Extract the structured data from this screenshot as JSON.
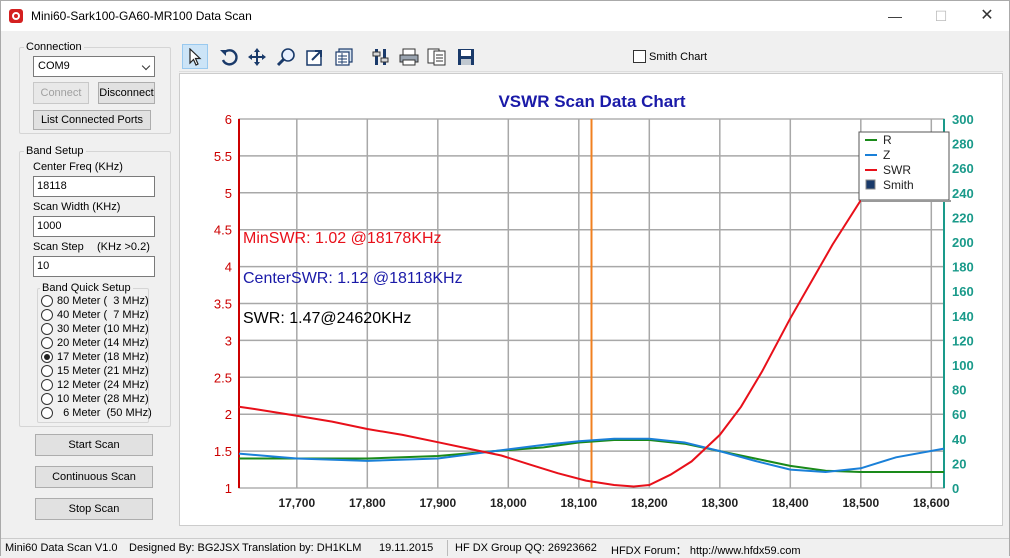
{
  "window": {
    "title": "Mini60-Sark100-GA60-MR100 Data Scan",
    "minimize": "—",
    "maximize": "☐",
    "close": "✕"
  },
  "connection": {
    "group_title": "Connection",
    "port_value": "COM9",
    "connect_label": "Connect",
    "disconnect_label": "Disconnect",
    "list_ports_label": "List Connected Ports"
  },
  "band_setup": {
    "group_title": "Band Setup",
    "center_freq_label": "Center Freq  (KHz)",
    "center_freq_value": "18118",
    "scan_width_label": "Scan Width   (KHz)",
    "scan_width_value": "1000",
    "scan_step_label": "Scan Step",
    "scan_step_hint": "(KHz >0.2)",
    "scan_step_value": "10",
    "quick_setup_title": "Band Quick Setup",
    "bands": [
      {
        "label": "80 Meter (  3 MHz)",
        "checked": false
      },
      {
        "label": "40 Meter (  7 MHz)",
        "checked": false
      },
      {
        "label": "30 Meter (10 MHz)",
        "checked": false
      },
      {
        "label": "20 Meter (14 MHz)",
        "checked": false
      },
      {
        "label": "17 Meter (18 MHz)",
        "checked": true
      },
      {
        "label": "15 Meter (21 MHz)",
        "checked": false
      },
      {
        "label": "12 Meter (24 MHz)",
        "checked": false
      },
      {
        "label": "10 Meter (28 MHz)",
        "checked": false
      },
      {
        "label": "  6 Meter  (50 MHz)",
        "checked": false
      }
    ]
  },
  "actions": {
    "start_scan": "Start Scan",
    "continuous_scan": "Continuous Scan",
    "stop_scan": "Stop Scan"
  },
  "toolbar": {
    "tools": [
      "pointer-icon",
      "rotate-icon",
      "pan-icon",
      "zoom-icon",
      "export-icon",
      "data-icon",
      "settings-icon",
      "print-icon",
      "copy-icon",
      "save-icon"
    ],
    "smith_chart_label": "Smith Chart",
    "smith_chart_checked": false
  },
  "status": {
    "version": "Mini60 Data Scan V1.0",
    "designed_by": "Designed By: BG2JSX",
    "translation": "Translation by: DH1KLM",
    "date": "19.11.2015",
    "group": "HF DX Group QQ: 26923662",
    "forum": "HFDX Forum：  http://www.hfdx59.com"
  },
  "colors": {
    "swr": "#e8101a",
    "r": "#1a8a1a",
    "z": "#1a80d8",
    "marker": "#f08020",
    "title": "#1a1aa8",
    "axis_left": "#cc0000",
    "axis_right": "#1a9a8a"
  },
  "chart_data": {
    "type": "line",
    "title": "VSWR Scan Data Chart",
    "xlim": [
      17618,
      18618
    ],
    "x_ticks": [
      "17,700",
      "17,800",
      "17,900",
      "18,000",
      "18,100",
      "18,200",
      "18,300",
      "18,400",
      "18,500",
      "18,600"
    ],
    "ylim_left": [
      1,
      6
    ],
    "y_ticks_left": [
      "1",
      "1.5",
      "2",
      "2.5",
      "3",
      "3.5",
      "4",
      "4.5",
      "5",
      "5.5",
      "6"
    ],
    "ylim_right": [
      0,
      300
    ],
    "y_ticks_right": [
      "0",
      "20",
      "40",
      "60",
      "80",
      "100",
      "120",
      "140",
      "160",
      "180",
      "200",
      "220",
      "240",
      "260",
      "280",
      "300"
    ],
    "grid": true,
    "legend_position": "top-right",
    "legend": [
      "R",
      "Z",
      "SWR",
      "Smith"
    ],
    "marker_x": 18118,
    "annotations": [
      {
        "text": "MinSWR: 1.02 @18178KHz",
        "color": "#e8101a"
      },
      {
        "text": "CenterSWR: 1.12 @18118KHz",
        "color": "#1a1aa8"
      },
      {
        "text": "SWR: 1.47@24620KHz",
        "color": "#000000"
      }
    ],
    "series": [
      {
        "name": "SWR",
        "axis": "left",
        "x": [
          17618,
          17640,
          17700,
          17750,
          17800,
          17850,
          17900,
          17950,
          17990,
          18030,
          18070,
          18110,
          18150,
          18178,
          18200,
          18230,
          18260,
          18300,
          18330,
          18360,
          18400,
          18430,
          18460,
          18500,
          18530,
          18560,
          18590,
          18618
        ],
        "values": [
          2.1,
          2.07,
          1.98,
          1.9,
          1.8,
          1.72,
          1.62,
          1.52,
          1.44,
          1.32,
          1.2,
          1.1,
          1.04,
          1.02,
          1.04,
          1.18,
          1.36,
          1.72,
          2.1,
          2.58,
          3.3,
          3.8,
          4.3,
          4.9,
          5.2,
          5.5,
          5.72,
          5.82
        ]
      },
      {
        "name": "R",
        "axis": "right",
        "x": [
          17618,
          17700,
          17800,
          17900,
          17980,
          18050,
          18100,
          18150,
          18200,
          18250,
          18300,
          18350,
          18400,
          18450,
          18500,
          18550,
          18618
        ],
        "values": [
          24,
          24,
          24,
          26,
          30,
          33,
          37,
          39,
          39,
          36,
          30,
          24,
          18,
          14,
          13,
          13,
          13
        ]
      },
      {
        "name": "Z",
        "axis": "right",
        "x": [
          17618,
          17700,
          17800,
          17900,
          17980,
          18050,
          18100,
          18150,
          18200,
          18250,
          18300,
          18350,
          18400,
          18450,
          18500,
          18550,
          18618
        ],
        "values": [
          28,
          24,
          22,
          24,
          30,
          35,
          38,
          40,
          40,
          37,
          30,
          22,
          15,
          13,
          16,
          25,
          32
        ]
      }
    ]
  }
}
